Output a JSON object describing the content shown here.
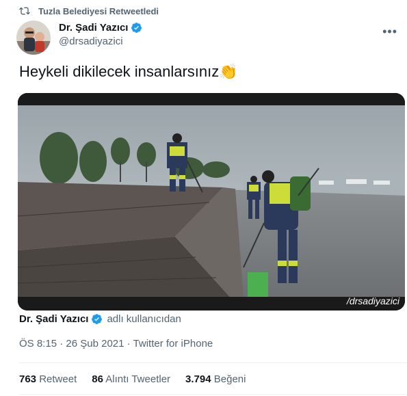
{
  "retweet": {
    "label": "Tuzla Belediyesi Retweetledi",
    "icon": "retweet-icon"
  },
  "author": {
    "name": "Dr. Şadi Yazıcı",
    "handle": "@drsadiyazici",
    "verified": true
  },
  "tweet": {
    "text": "Heykeli dikilecek insanlarsınız",
    "emoji": "👏"
  },
  "media": {
    "watermark": "/drsadiyazici"
  },
  "source_attribution": {
    "name": "Dr. Şadi Yazıcı",
    "suffix": "adlı kullanıcıdan"
  },
  "meta": {
    "time": "ÖS 8:15",
    "separator": "·",
    "date": "26 Şub 2021",
    "client": "Twitter for iPhone"
  },
  "stats": [
    {
      "count": "763",
      "label": "Retweet"
    },
    {
      "count": "86",
      "label": "Alıntı Tweetler"
    },
    {
      "count": "3.794",
      "label": "Beğeni"
    }
  ],
  "colors": {
    "secondary_text": "#536471",
    "verified_blue": "#1d9bf0",
    "divider": "#eff3f4"
  }
}
